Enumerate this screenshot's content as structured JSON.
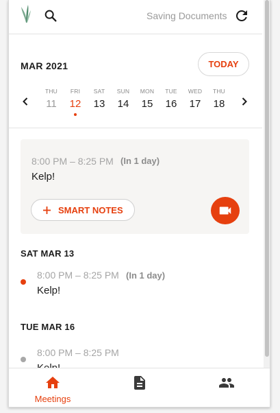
{
  "header": {
    "status_text": "Saving Documents",
    "logo_icon": "leaf-logo-icon",
    "search_icon": "search-icon",
    "refresh_icon": "refresh-icon"
  },
  "calendar": {
    "month_label": "MAR 2021",
    "today_label": "TODAY",
    "days": [
      {
        "name": "THU",
        "num": "11",
        "state": "past"
      },
      {
        "name": "FRI",
        "num": "12",
        "state": "selected"
      },
      {
        "name": "SAT",
        "num": "13",
        "state": ""
      },
      {
        "name": "SUN",
        "num": "14",
        "state": ""
      },
      {
        "name": "MON",
        "num": "15",
        "state": ""
      },
      {
        "name": "TUE",
        "num": "16",
        "state": ""
      },
      {
        "name": "WED",
        "num": "17",
        "state": ""
      },
      {
        "name": "THU",
        "num": "18",
        "state": ""
      }
    ]
  },
  "current_meeting": {
    "time": "8:00 PM – 8:25 PM",
    "relative": "(In 1 day)",
    "title": "Kelp!",
    "smart_notes_label": "SMART NOTES",
    "video_icon": "video-camera-icon"
  },
  "sections": [
    {
      "heading": "SAT MAR 13",
      "time": "8:00 PM – 8:25 PM",
      "relative": "(In 1 day)",
      "title": "Kelp!",
      "dot_color": "#e6400f"
    },
    {
      "heading": "TUE MAR 16",
      "time": "8:00 PM – 8:25 PM",
      "relative": "",
      "title": "Kelp!",
      "dot_color": "#a8a8a8"
    }
  ],
  "nav": {
    "meetings_label": "Meetings"
  },
  "colors": {
    "accent": "#e6400f"
  }
}
